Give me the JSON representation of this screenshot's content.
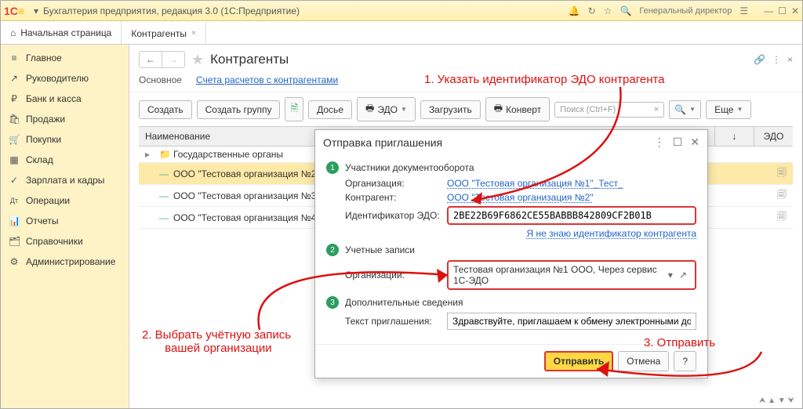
{
  "titlebar": {
    "logo_text": "1С",
    "app_title": "Бухгалтерия предприятия, редакция 3.0   (1С:Предприятие)",
    "user": "Генеральный директор"
  },
  "tabs": {
    "home_icon": "⌂",
    "home": "Начальная страница",
    "active": "Контрагенты"
  },
  "sidebar": [
    {
      "icon": "≡",
      "label": "Главное"
    },
    {
      "icon": "↗",
      "label": "Руководителю"
    },
    {
      "icon": "₽",
      "label": "Банк и касса"
    },
    {
      "icon": "🛍",
      "label": "Продажи"
    },
    {
      "icon": "🛒",
      "label": "Покупки"
    },
    {
      "icon": "▦",
      "label": "Склад"
    },
    {
      "icon": "✓",
      "label": "Зарплата и кадры"
    },
    {
      "icon": "Дт",
      "label": "Операции"
    },
    {
      "icon": "📊",
      "label": "Отчеты"
    },
    {
      "icon": "🗂",
      "label": "Справочники"
    },
    {
      "icon": "⚙",
      "label": "Администрирование"
    }
  ],
  "page": {
    "title": "Контрагенты",
    "subtabs": {
      "main": "Основное",
      "accounts": "Счета расчетов с контрагентами"
    }
  },
  "toolbar": {
    "create": "Создать",
    "create_group": "Создать группу",
    "dossier": "Досье",
    "edo": "ЭДО",
    "load": "Загрузить",
    "envelope": "Конверт",
    "search_placeholder": "Поиск (Ctrl+F)",
    "more": "Еще"
  },
  "grid": {
    "header_name": "Наименование",
    "header_arrow": "↓",
    "header_edo": "ЭДО",
    "rows": [
      {
        "type": "folder",
        "name": "Государственные органы"
      },
      {
        "type": "item",
        "name": "ООО \"Тестовая организация №2\"",
        "selected": true
      },
      {
        "type": "item",
        "name": "ООО \"Тестовая организация №3\""
      },
      {
        "type": "item",
        "name": "ООО \"Тестовая организация №4\""
      }
    ]
  },
  "modal": {
    "title": "Отправка приглашения",
    "step1": "Участники документооборота",
    "org_label": "Организация:",
    "org_value": "ООО \"Тестовая организация №1\"_Тест_",
    "counter_label": "Контрагент:",
    "counter_value": "ООО \"Тестовая организация №2\"",
    "edo_id_label": "Идентификатор ЭДО:",
    "edo_id_value": "2BE22B69F6862CE55BABBB842809CF2B01B",
    "unknown_link": "Я не знаю идентификатор контрагента",
    "step2": "Учетные записи",
    "accounts_label": "Организации:",
    "accounts_value": "Тестовая организация №1 ООО, Через сервис 1С-ЭДО",
    "step3": "Дополнительные сведения",
    "msg_label": "Текст приглашения:",
    "msg_value": "Здравствуйте, приглашаем к обмену электронными документами.",
    "send": "Отправить",
    "cancel": "Отмена",
    "help": "?"
  },
  "annotations": {
    "a1": "1. Указать идентификатор ЭДО контрагента",
    "a2": "2. Выбрать учётную запись\n       вашей организации",
    "a3": "3. Отправить"
  }
}
